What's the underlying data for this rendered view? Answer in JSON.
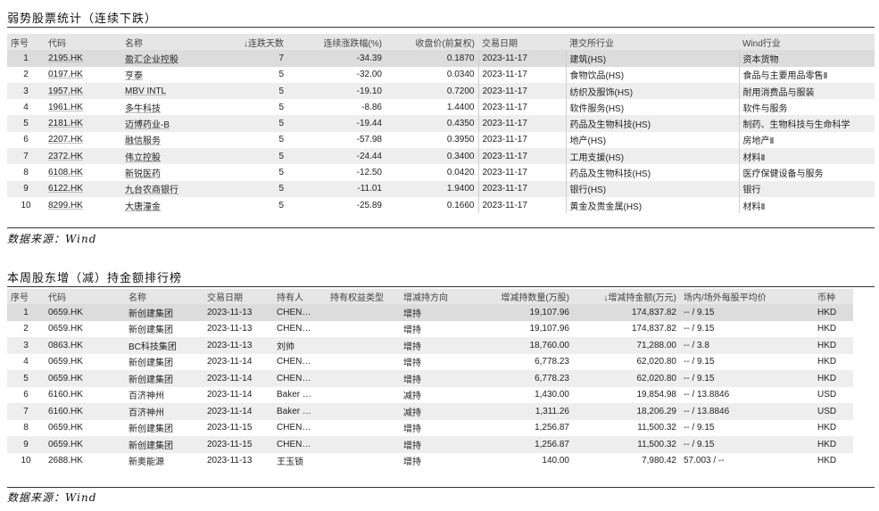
{
  "section1": {
    "title": "弱势股票统计（连续下跌）",
    "headers": [
      "序号",
      "代码",
      "名称",
      "↓连跌天数",
      "连续涨跌幅(%)",
      "收盘价(前复权)",
      "交易日期",
      "港交所行业",
      "Wind行业"
    ],
    "rows": [
      [
        "1",
        "2195.HK",
        "盈汇企业控股",
        "7",
        "-34.39",
        "0.1870",
        "2023-11-17",
        "建筑(HS)",
        "资本货物"
      ],
      [
        "2",
        "0197.HK",
        "亨泰",
        "5",
        "-32.00",
        "0.0340",
        "2023-11-17",
        "食物饮品(HS)",
        "食品与主要用品零售Ⅱ"
      ],
      [
        "3",
        "1957.HK",
        "MBV INTL",
        "5",
        "-19.10",
        "0.7200",
        "2023-11-17",
        "纺织及服饰(HS)",
        "耐用消费品与服装"
      ],
      [
        "4",
        "1961.HK",
        "多牛科技",
        "5",
        "-8.86",
        "1.4400",
        "2023-11-17",
        "软件服务(HS)",
        "软件与服务"
      ],
      [
        "5",
        "2181.HK",
        "迈博药业-B",
        "5",
        "-19.44",
        "0.4350",
        "2023-11-17",
        "药品及生物科技(HS)",
        "制药、生物科技与生命科学"
      ],
      [
        "6",
        "2207.HK",
        "融信服务",
        "5",
        "-57.98",
        "0.3950",
        "2023-11-17",
        "地产(HS)",
        "房地产Ⅱ"
      ],
      [
        "7",
        "2372.HK",
        "伟立控股",
        "5",
        "-24.44",
        "0.3400",
        "2023-11-17",
        "工用支援(HS)",
        "材料Ⅱ"
      ],
      [
        "8",
        "6108.HK",
        "新锐医药",
        "5",
        "-12.50",
        "0.0420",
        "2023-11-17",
        "药品及生物科技(HS)",
        "医疗保健设备与服务"
      ],
      [
        "9",
        "6122.HK",
        "九台农商银行",
        "5",
        "-11.01",
        "1.9400",
        "2023-11-17",
        "银行(HS)",
        "银行"
      ],
      [
        "10",
        "8299.HK",
        "大唐潼金",
        "5",
        "-25.89",
        "0.1660",
        "2023-11-17",
        "黄金及贵金属(HS)",
        "材料Ⅱ"
      ]
    ],
    "source": "数据来源：Wind"
  },
  "section2": {
    "title": "本周股东增（减）持金额排行榜",
    "headers": [
      "序号",
      "代码",
      "名称",
      "交易日期",
      "持有人",
      "持有权益类型",
      "增减持方向",
      "增减持数量(万股)",
      "↓增减持金额(万元)",
      "场内/场外每股平均价",
      "币种"
    ],
    "rows": [
      [
        "1",
        "0659.HK",
        "新创建集团",
        "2023-11-13",
        "CHEN…",
        "",
        "增持",
        "19,107.96",
        "174,837.82",
        "-- / 9.15",
        "HKD"
      ],
      [
        "2",
        "0659.HK",
        "新创建集团",
        "2023-11-13",
        "CHEN…",
        "",
        "增持",
        "19,107.96",
        "174,837.82",
        "-- / 9.15",
        "HKD"
      ],
      [
        "3",
        "0863.HK",
        "BC科技集团",
        "2023-11-13",
        "刘帅",
        "",
        "增持",
        "18,760.00",
        "71,288.00",
        "-- / 3.8",
        "HKD"
      ],
      [
        "4",
        "0659.HK",
        "新创建集团",
        "2023-11-14",
        "CHEN…",
        "",
        "增持",
        "6,778.23",
        "62,020.80",
        "-- / 9.15",
        "HKD"
      ],
      [
        "5",
        "0659.HK",
        "新创建集团",
        "2023-11-14",
        "CHEN…",
        "",
        "增持",
        "6,778.23",
        "62,020.80",
        "-- / 9.15",
        "HKD"
      ],
      [
        "6",
        "6160.HK",
        "百济神州",
        "2023-11-14",
        "Baker …",
        "",
        "减持",
        "1,430.00",
        "19,854.98",
        "-- / 13.8846",
        "USD"
      ],
      [
        "7",
        "6160.HK",
        "百济神州",
        "2023-11-14",
        "Baker …",
        "",
        "减持",
        "1,311.26",
        "18,206.29",
        "-- / 13.8846",
        "USD"
      ],
      [
        "8",
        "0659.HK",
        "新创建集团",
        "2023-11-15",
        "CHEN…",
        "",
        "增持",
        "1,256.87",
        "11,500.32",
        "-- / 9.15",
        "HKD"
      ],
      [
        "9",
        "0659.HK",
        "新创建集团",
        "2023-11-15",
        "CHEN…",
        "",
        "增持",
        "1,256.87",
        "11,500.32",
        "-- / 9.15",
        "HKD"
      ],
      [
        "10",
        "2688.HK",
        "新奥能源",
        "2023-11-13",
        "王玉锁",
        "",
        "增持",
        "140.00",
        "7,980.42",
        "57.003 / --",
        "HKD"
      ]
    ],
    "source": "数据来源：Wind"
  }
}
